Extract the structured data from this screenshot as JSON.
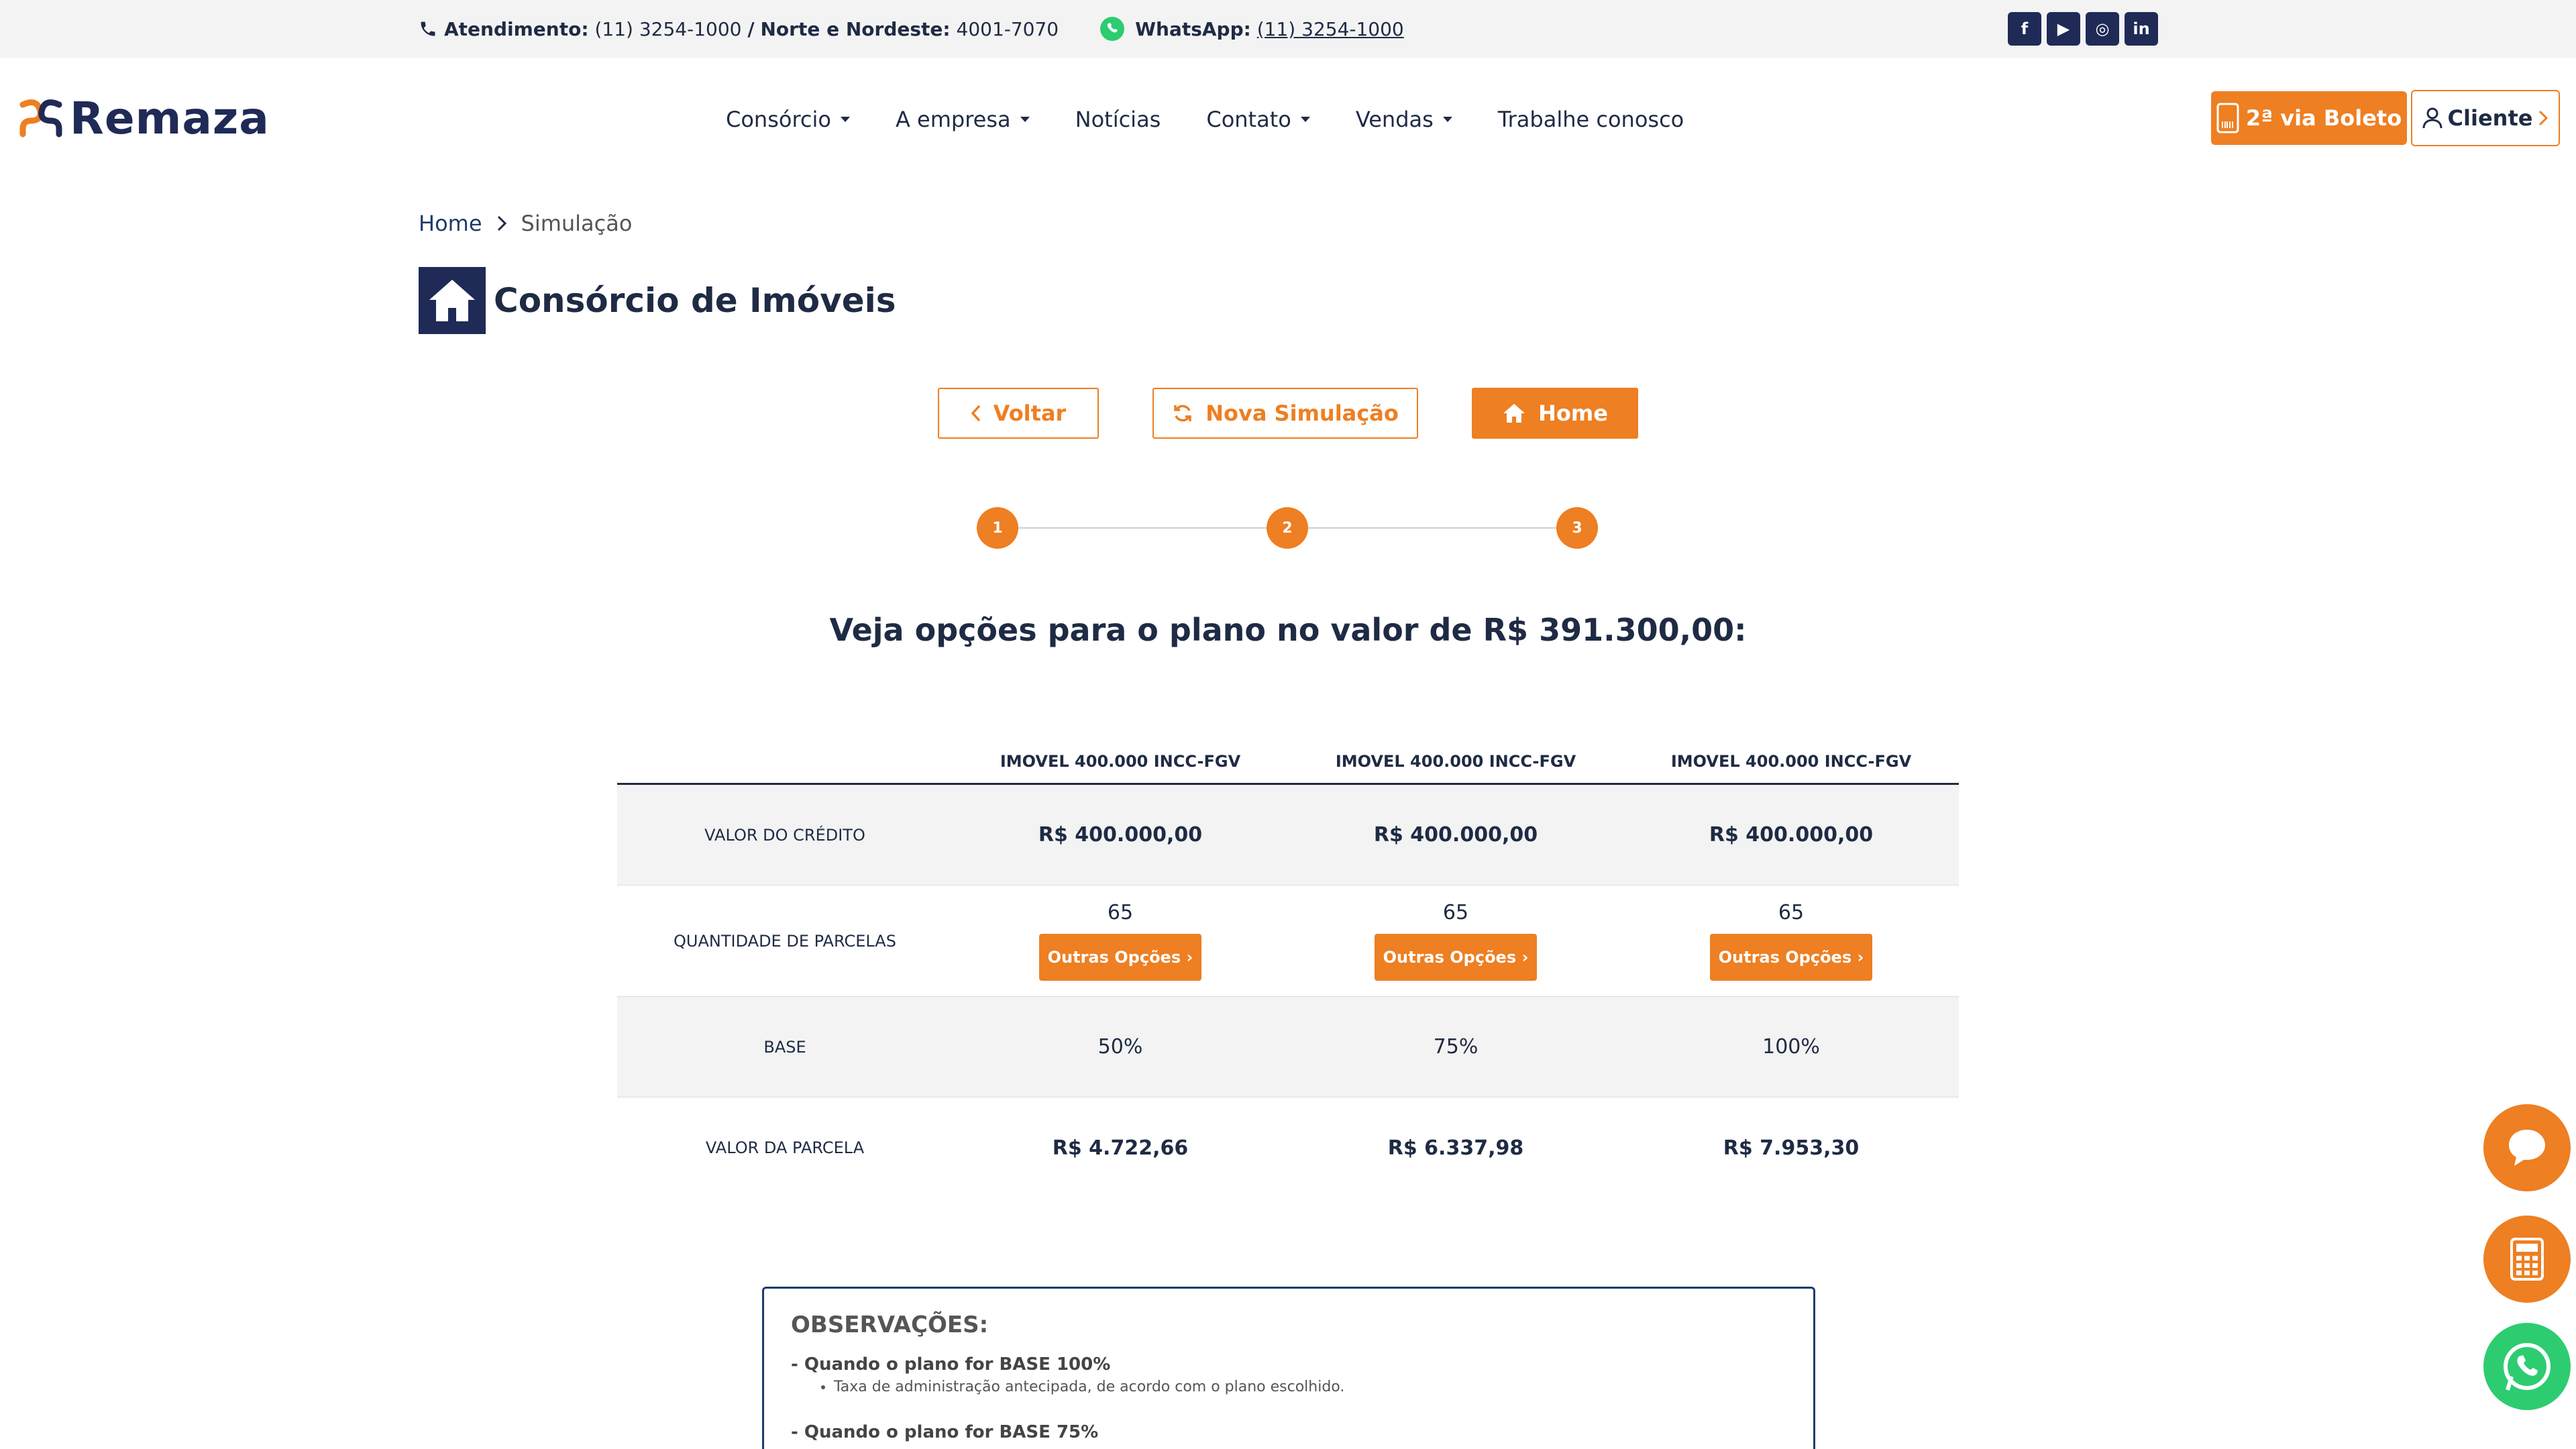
{
  "topbar": {
    "atendimento_label": "Atendimento:",
    "atendimento_phone": "(11) 3254-1000",
    "slash": "/",
    "nordeste_label": "Norte e Nordeste:",
    "nordeste_phone": "4001-7070",
    "whatsapp_label": "WhatsApp:",
    "whatsapp_phone": "(11) 3254-1000",
    "socials": [
      "f",
      "▶",
      "◎",
      "in"
    ]
  },
  "logo": {
    "text": "Remaza"
  },
  "nav": {
    "items": [
      {
        "label": "Consórcio",
        "dropdown": true
      },
      {
        "label": "A empresa",
        "dropdown": true
      },
      {
        "label": "Notícias",
        "dropdown": false
      },
      {
        "label": "Contato",
        "dropdown": true
      },
      {
        "label": "Vendas",
        "dropdown": true
      },
      {
        "label": "Trabalhe conosco",
        "dropdown": false
      }
    ],
    "boleto_label": "2ª via Boleto",
    "cliente_label": "Cliente"
  },
  "breadcrumb": {
    "home": "Home",
    "current": "Simulação"
  },
  "page": {
    "title": "Consórcio de Imóveis"
  },
  "actions": {
    "voltar": "Voltar",
    "nova": "Nova Simulação",
    "home": "Home"
  },
  "stepper": {
    "steps": [
      "1",
      "2",
      "3"
    ]
  },
  "plan": {
    "title": "Veja opções para o plano no valor de R$ 391.300,00:"
  },
  "table": {
    "headers": [
      "IMOVEL 400.000 INCC-FGV",
      "IMOVEL 400.000 INCC-FGV",
      "IMOVEL 400.000 INCC-FGV"
    ],
    "rows": {
      "credito": {
        "label": "VALOR DO CRÉDITO",
        "values": [
          "R$ 400.000,00",
          "R$ 400.000,00",
          "R$ 400.000,00"
        ]
      },
      "parcelas": {
        "label": "QUANTIDADE DE PARCELAS",
        "values": [
          "65",
          "65",
          "65"
        ],
        "button": "Outras Opções"
      },
      "base": {
        "label": "BASE",
        "values": [
          "50%",
          "75%",
          "100%"
        ]
      },
      "parcela": {
        "label": "VALOR DA PARCELA",
        "values": [
          "R$ 4.722,66",
          "R$ 6.337,98",
          "R$ 7.953,30"
        ]
      }
    }
  },
  "observacoes": {
    "title": "OBSERVAÇÕES:",
    "items": [
      {
        "head": "- Quando o plano for BASE 100%",
        "bullet": "Taxa de administração antecipada, de acordo com o plano escolhido."
      },
      {
        "head": "- Quando o plano for BASE 75%"
      }
    ]
  },
  "colors": {
    "accent": "#ee7f22",
    "brand": "#1f2b56",
    "whatsapp": "#2ecc71"
  }
}
